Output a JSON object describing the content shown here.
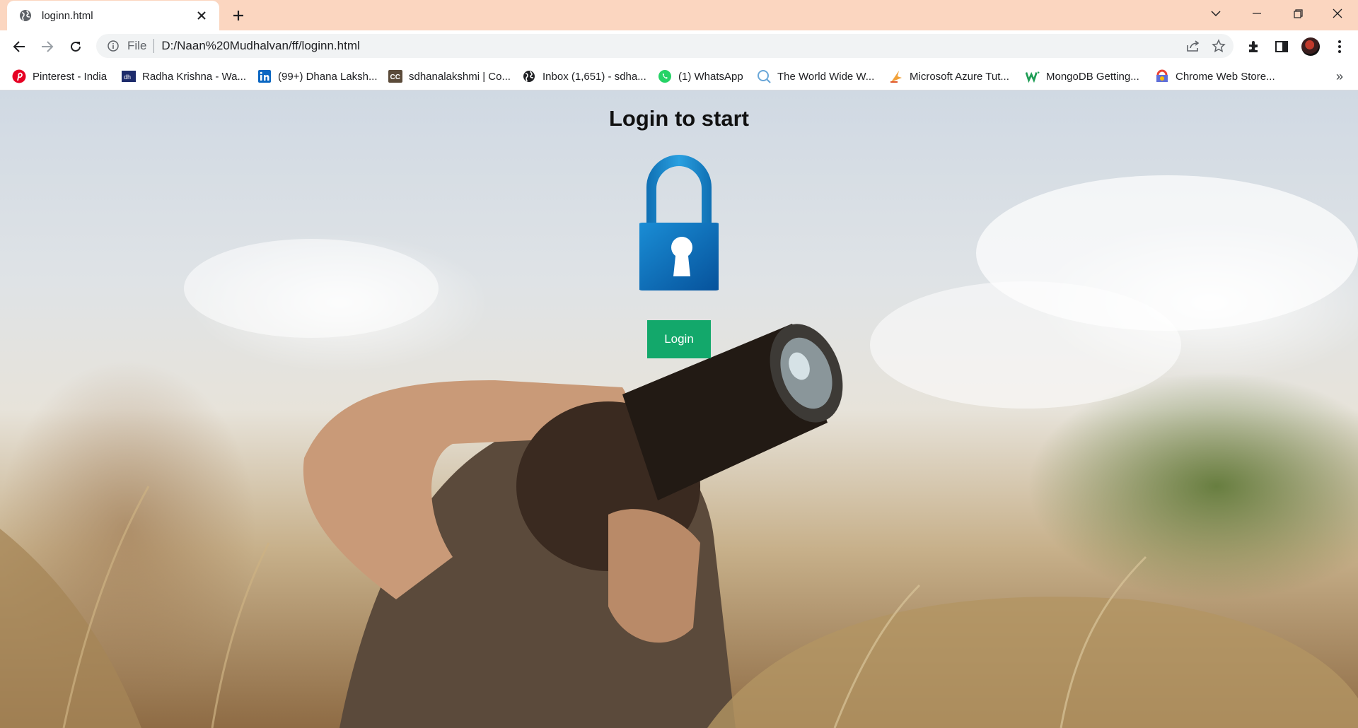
{
  "browser": {
    "tab": {
      "title": "loginn.html"
    },
    "address_bar": {
      "scheme_label": "File",
      "url": "D:/Naan%20Mudhalvan/ff/loginn.html"
    },
    "bookmarks": [
      {
        "label": "Pinterest - India",
        "icon": "pinterest-icon"
      },
      {
        "label": "Radha Krishna - Wa...",
        "icon": "bookmark-site-icon"
      },
      {
        "label": "(99+) Dhana Laksh...",
        "icon": "linkedin-icon"
      },
      {
        "label": "sdhanalakshmi | Co...",
        "icon": "cc-icon"
      },
      {
        "label": "Inbox (1,651) - sdha...",
        "icon": "globe-icon"
      },
      {
        "label": "(1) WhatsApp",
        "icon": "whatsapp-icon"
      },
      {
        "label": "The World Wide W...",
        "icon": "w3-icon"
      },
      {
        "label": "Microsoft Azure Tut...",
        "icon": "azure-icon"
      },
      {
        "label": "MongoDB Getting...",
        "icon": "mongodb-icon"
      },
      {
        "label": "Chrome Web Store...",
        "icon": "chrome-store-icon"
      }
    ],
    "colors": {
      "tab_strip": "#fbd6c0"
    }
  },
  "page": {
    "heading": "Login to start",
    "login_button": "Login",
    "colors": {
      "button": "#13a86b",
      "lock": "#0a6db4"
    }
  }
}
